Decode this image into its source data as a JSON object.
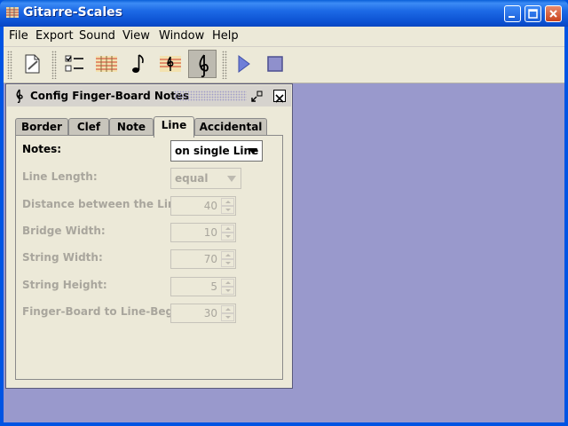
{
  "window": {
    "title": "Gitarre-Scales",
    "icon": "guitar-frets-icon"
  },
  "menubar": {
    "items": [
      {
        "label": "File"
      },
      {
        "label": "Export"
      },
      {
        "label": "Sound"
      },
      {
        "label": "View"
      },
      {
        "label": "Window"
      },
      {
        "label": "Help"
      }
    ]
  },
  "toolbar": {
    "tools": [
      {
        "icon": "document-icon"
      },
      {
        "icon": "checklist-icon"
      },
      {
        "icon": "fretboard-icon"
      },
      {
        "icon": "note-icon"
      },
      {
        "icon": "staff-clef-icon"
      },
      {
        "icon": "clef-icon",
        "pressed": true
      },
      {
        "icon": "play-icon"
      },
      {
        "icon": "stop-icon"
      }
    ]
  },
  "config": {
    "title": "Config Finger-Board Notes",
    "tabs": [
      {
        "label": "Border"
      },
      {
        "label": "Clef"
      },
      {
        "label": "Note"
      },
      {
        "label": "Line",
        "active": true
      },
      {
        "label": "Accidental"
      }
    ],
    "rows": [
      {
        "label": "Notes:",
        "type": "combo",
        "value": "on single Line",
        "enabled": true
      },
      {
        "label": "Line Length:",
        "type": "combo",
        "value": "equal",
        "enabled": false
      },
      {
        "label": "Distance between the Lines:",
        "type": "spin",
        "value": "40",
        "enabled": false
      },
      {
        "label": "Bridge Width:",
        "type": "spin",
        "value": "10",
        "enabled": false
      },
      {
        "label": "String Width:",
        "type": "spin",
        "value": "70",
        "enabled": false
      },
      {
        "label": "String Height:",
        "type": "spin",
        "value": "5",
        "enabled": false
      },
      {
        "label": "Finger-Board to Line-Begin:",
        "type": "spin",
        "value": "30",
        "enabled": false
      }
    ]
  },
  "colors": {
    "titlebar": "#0054e3",
    "desktop": "#9999cc",
    "disabled_text": "#a9a69d"
  }
}
